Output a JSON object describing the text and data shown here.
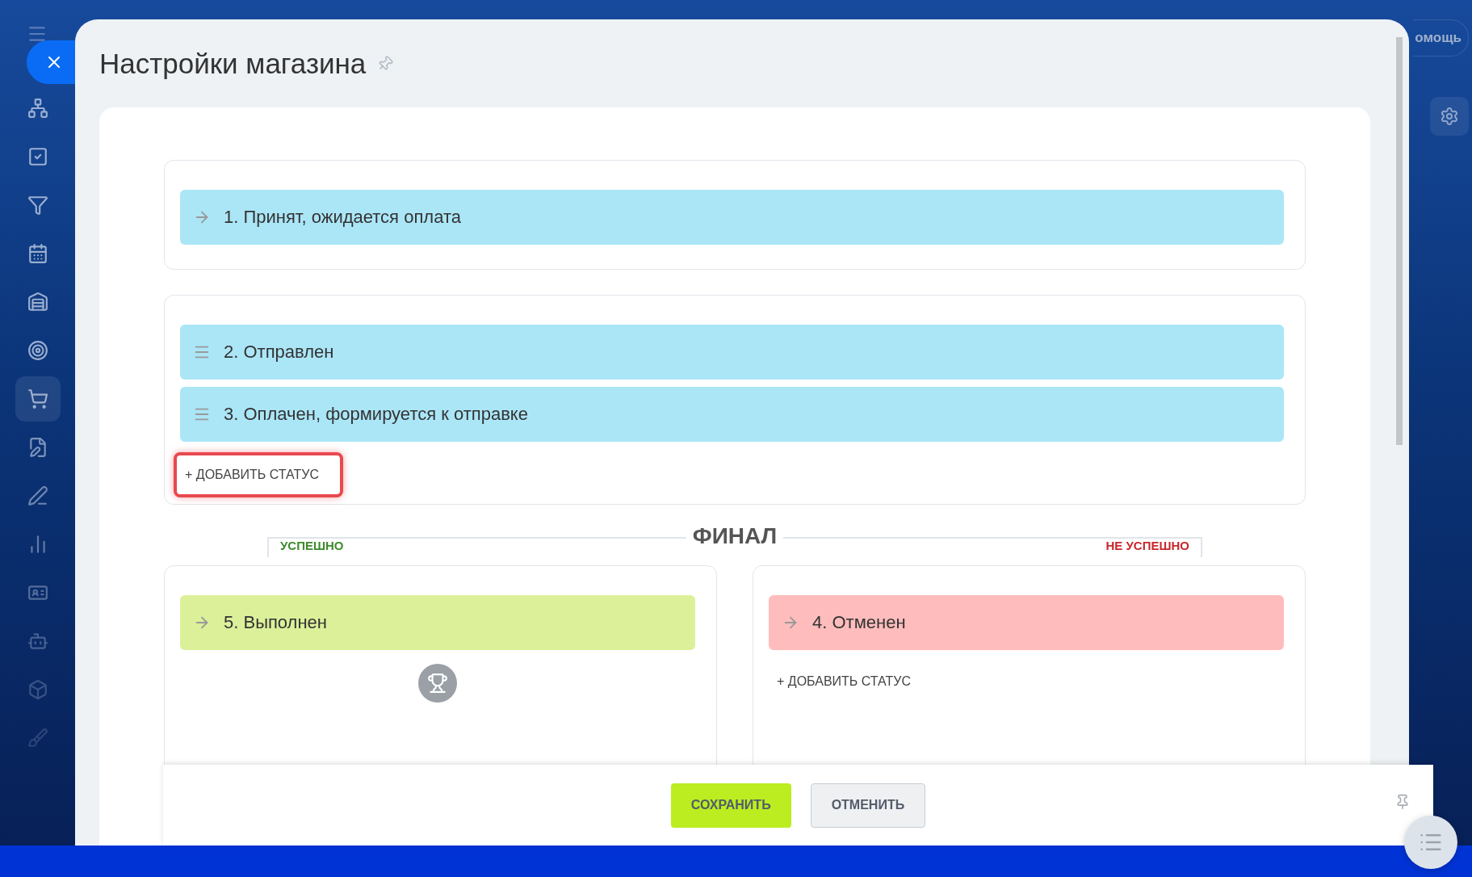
{
  "sidebar": {
    "items": [
      {
        "selected": false
      },
      {
        "selected": false
      },
      {
        "selected": false
      },
      {
        "selected": false
      },
      {
        "selected": false
      },
      {
        "selected": false
      },
      {
        "selected": true
      },
      {
        "selected": false
      },
      {
        "selected": false
      },
      {
        "selected": false
      },
      {
        "selected": false
      },
      {
        "selected": false
      },
      {
        "selected": false
      },
      {
        "selected": false
      }
    ]
  },
  "background": {
    "help_button": "омощь"
  },
  "panel": {
    "title": "Настройки магазина"
  },
  "start_group": {
    "statuses": [
      {
        "label": "1. Принят, ожидается оплата",
        "kind": "fixed",
        "color": "#abe6f7"
      }
    ]
  },
  "intermediate_group": {
    "statuses": [
      {
        "label": "2. Отправлен",
        "kind": "draggable",
        "color": "#abe6f7"
      },
      {
        "label": "3. Оплачен, формируется к отправке",
        "kind": "draggable",
        "color": "#abe6f7"
      }
    ],
    "add_button": {
      "label": "+ ДОБАВИТЬ СТАТУС",
      "highlighted": true
    }
  },
  "final": {
    "title": "ФИНАЛ",
    "success_label": "УСПЕШНО",
    "failure_label": "НЕ УСПЕШНО",
    "success": {
      "statuses": [
        {
          "label": "5. Выполнен",
          "kind": "fixed",
          "color": "#dcf09a"
        }
      ]
    },
    "failure": {
      "statuses": [
        {
          "label": "4. Отменен",
          "kind": "fixed",
          "color": "#ffbcbc"
        }
      ],
      "add_button": {
        "label": "+ ДОБАВИТЬ СТАТУС",
        "highlighted": false
      }
    }
  },
  "footer": {
    "buttons": [
      {
        "label": "СОХРАНИТЬ",
        "kind": "primary"
      },
      {
        "label": "ОТМЕНИТЬ",
        "kind": "secondary"
      }
    ]
  }
}
